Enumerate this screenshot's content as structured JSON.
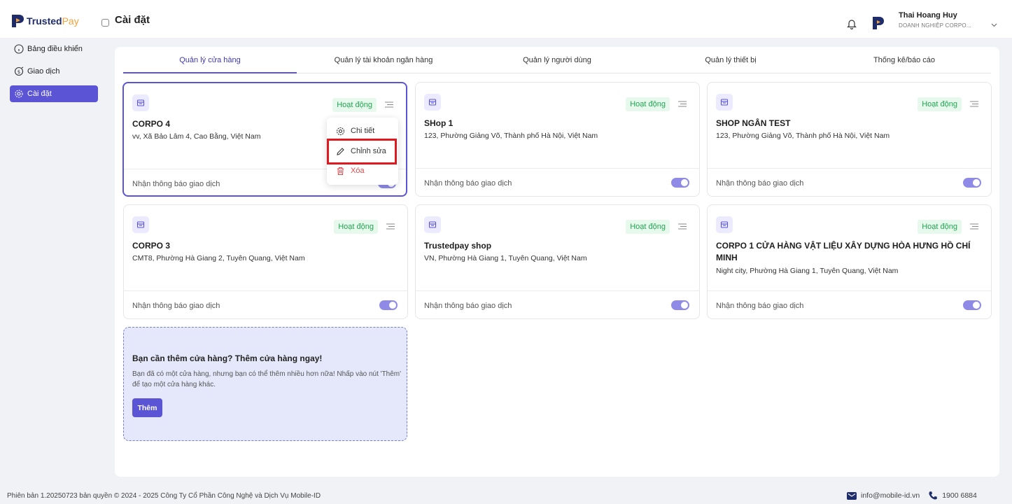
{
  "brand": {
    "name_part1": "Trusted",
    "name_part2": "Pay"
  },
  "header": {
    "title": "Cài đặt",
    "user_name": "Thai Hoang Huy",
    "user_role": "DOANH NGHIỆP CORPO..."
  },
  "sidebar": {
    "items": [
      {
        "label": "Bảng điều khiển",
        "icon": "dashboard-icon"
      },
      {
        "label": "Giao dịch",
        "icon": "transaction-icon"
      },
      {
        "label": "Cài đặt",
        "icon": "settings-icon",
        "active": true
      }
    ]
  },
  "tabs": [
    {
      "label": "Quản lý cửa hàng",
      "active": true
    },
    {
      "label": "Quản lý tài khoản ngân hàng"
    },
    {
      "label": "Quản lý người dùng"
    },
    {
      "label": "Quản lý thiết bị"
    },
    {
      "label": "Thống kê/báo cáo"
    }
  ],
  "stores": [
    {
      "name": "CORPO 4",
      "address": "vv, Xã Bảo Lâm 4, Cao Bằng, Việt Nam",
      "status": "Hoạt động",
      "notify_label": "Nhận thông báo giao dịch",
      "notify_on": true
    },
    {
      "name": "SHop 1",
      "address": "123, Phường Giảng Võ, Thành phố Hà Nội, Việt Nam",
      "status": "Hoạt động",
      "notify_label": "Nhận thông báo giao dịch",
      "notify_on": true
    },
    {
      "name": "SHOP NGÂN TEST",
      "address": "123, Phường Giảng Võ, Thành phố Hà Nội, Việt Nam",
      "status": "Hoạt động",
      "notify_label": "Nhận thông báo giao dịch",
      "notify_on": true
    },
    {
      "name": "CORPO 3",
      "address": "CMT8, Phường Hà Giang 2, Tuyên Quang, Việt Nam",
      "status": "Hoạt động",
      "notify_label": "Nhận thông báo giao dịch",
      "notify_on": true
    },
    {
      "name": "Trustedpay shop",
      "address": "VN, Phường Hà Giang 1, Tuyên Quang, Việt Nam",
      "status": "Hoạt động",
      "notify_label": "Nhận thông báo giao dịch",
      "notify_on": true
    },
    {
      "name": "CORPO 1 CỬA HÀNG VẬT LIỆU XÂY DỰNG HÒA HƯNG HỒ CHÍ MINH",
      "address": "Night city, Phường Hà Giang 1, Tuyên Quang, Việt Nam",
      "status": "Hoạt động",
      "notify_label": "Nhận thông báo giao dịch",
      "notify_on": true
    }
  ],
  "dropdown": {
    "items": [
      {
        "label": "Chi tiết",
        "icon": "gear-icon"
      },
      {
        "label": "Chỉnh sửa",
        "icon": "pencil-icon"
      },
      {
        "label": "Xóa",
        "icon": "trash-icon"
      }
    ]
  },
  "add_store": {
    "title": "Bạn cần thêm cửa hàng? Thêm cửa hàng ngay!",
    "description": "Bạn đã có một cửa hàng, nhưng bạn có thể thêm nhiều hơn nữa! Nhấp vào nút 'Thêm' để tạo một cửa hàng khác.",
    "button": "Thêm"
  },
  "footer": {
    "copyright": "Phiên bản 1.20250723 bản quyền © 2024 - 2025 Công Ty Cổ Phần Công Nghệ và Dịch Vụ Mobile-ID",
    "email": "info@mobile-id.vn",
    "phone": "1900 6884"
  },
  "colors": {
    "accent": "#5b55d6",
    "status_green": "#1fa651",
    "danger": "#e5484d",
    "highlight": "#e0191f"
  }
}
